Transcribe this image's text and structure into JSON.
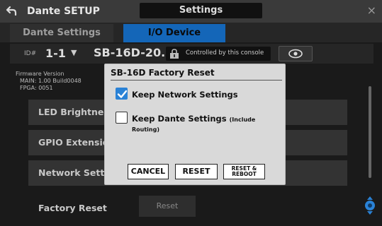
{
  "titlebar": {
    "app_title": "Dante SETUP",
    "center_title": "Settings",
    "close_icon": "×"
  },
  "tabs": [
    {
      "label": "Dante Settings",
      "active": false
    },
    {
      "label": "I/O Device",
      "active": true
    }
  ],
  "device": {
    "id_label": "ID#",
    "id_value": "1-1",
    "dropdown_icon": "▼",
    "name": "SB-16D-20...",
    "controlled_text": "Controlled by this console"
  },
  "firmware": {
    "label": "Firmware Version",
    "main": "MAIN: 1.00 Build0048",
    "fpga": "FPGA: 0051"
  },
  "rows": [
    {
      "label": "LED Brightness"
    },
    {
      "label": "GPIO Extension"
    },
    {
      "label": "Network Settin"
    },
    {
      "label": "Factory Reset",
      "button": "Reset"
    }
  ],
  "dialog": {
    "title": "SB-16D Factory Reset",
    "options": [
      {
        "label": "Keep Network Settings",
        "checked": true
      },
      {
        "label": "Keep Dante Settings",
        "note": "(Include Routing)",
        "checked": false
      }
    ],
    "buttons": {
      "cancel": "CANCEL",
      "reset": "RESET",
      "reset_reboot_line1": "RESET &",
      "reset_reboot_line2": "REBOOT"
    }
  },
  "colors": {
    "accent": "#1466b8",
    "checkbox": "#2a82d6",
    "scroll_knob": "#2a82d6"
  }
}
